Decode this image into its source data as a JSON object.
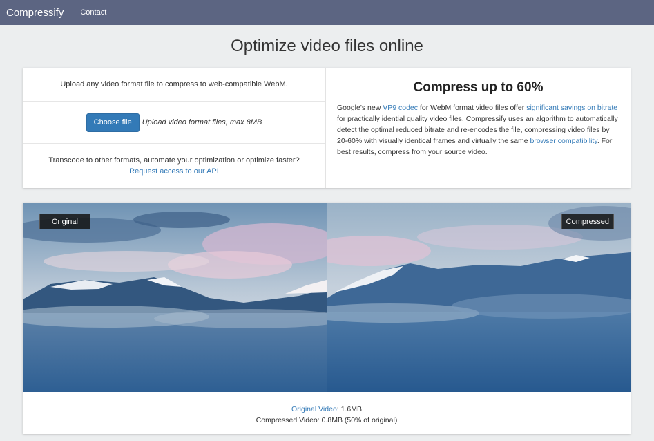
{
  "navbar": {
    "brand": "Compressify",
    "contact": "Contact"
  },
  "page_title": "Optimize video files online",
  "upload": {
    "intro": "Upload any video format file to compress to web-compatible WebM.",
    "choose_button": "Choose file",
    "hint": "Upload video format files, max 8MB",
    "api_text": "Transcode to other formats, automate your optimization or optimize faster?",
    "api_link": "Request access to our API"
  },
  "info": {
    "heading": "Compress up to 60%",
    "p1": "Google's new ",
    "link_vp9": "VP9 codec",
    "p2": " for WebM format video files offer ",
    "link_savings": "significant savings on bitrate",
    "p3": " for practically idential quality video files. Compressify uses an algorithm to automatically detect the optimal reduced bitrate and re-encodes the file, compressing video files by 20-60% with visually identical frames and virtually the same ",
    "link_browser": "browser compatibility",
    "p4": ". For best results, compress from your source video."
  },
  "comparison": {
    "label_original": "Original",
    "label_compressed": "Compressed",
    "original_link": "Original Video",
    "original_size": ": 1.6MB",
    "compressed_line": "Compressed Video: 0.8MB (50% of original)"
  },
  "colors": {
    "navbar": "#5c6582",
    "link": "#337ab7",
    "button": "#337ab7",
    "background": "#eceeef"
  }
}
